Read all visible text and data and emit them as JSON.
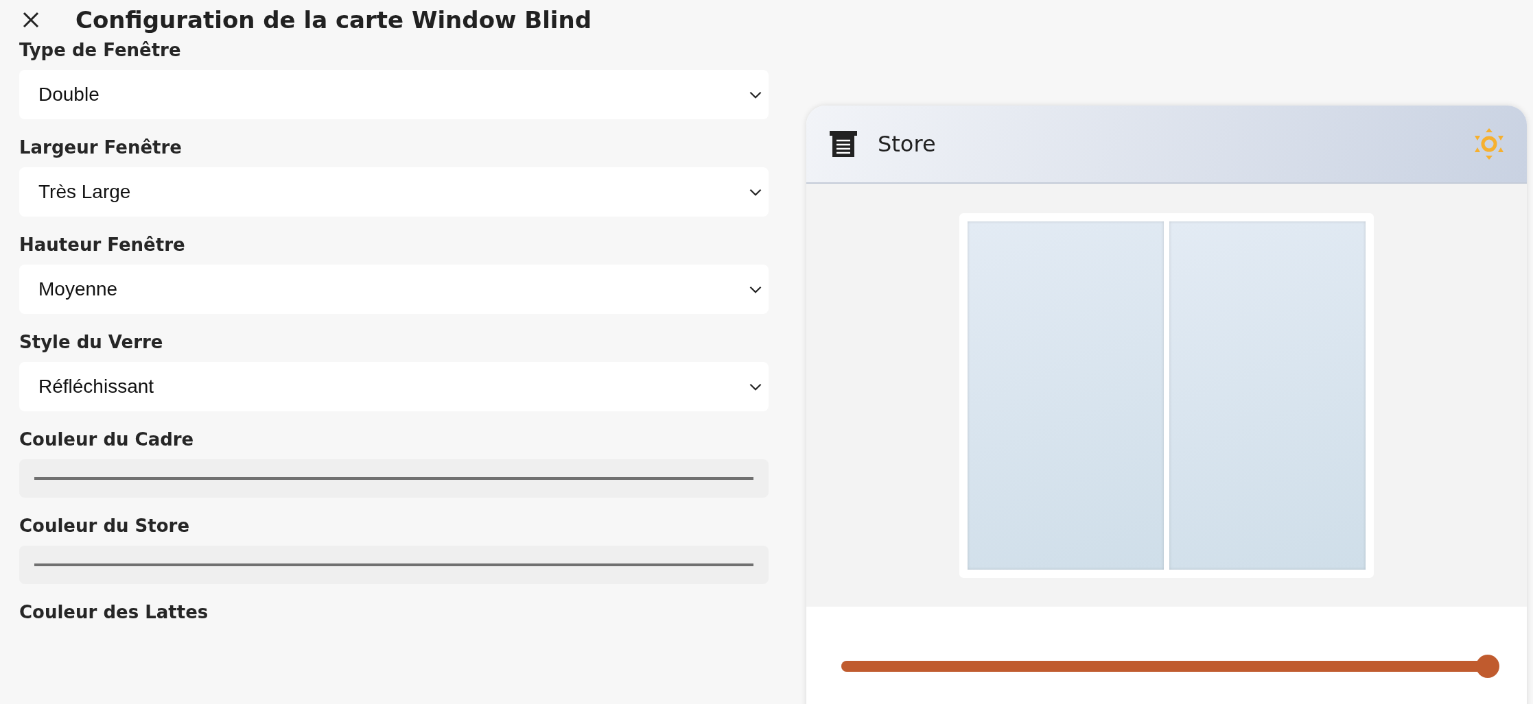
{
  "dialog": {
    "title": "Configuration de la carte Window Blind"
  },
  "fields": [
    {
      "kind": "select",
      "label": "Type de Fenêtre",
      "value": "Double"
    },
    {
      "kind": "select",
      "label": "Largeur Fenêtre",
      "value": "Très Large"
    },
    {
      "kind": "select",
      "label": "Hauteur Fenêtre",
      "value": "Moyenne"
    },
    {
      "kind": "select",
      "label": "Style du Verre",
      "value": "Réfléchissant"
    },
    {
      "kind": "color",
      "label": "Couleur du Cadre"
    },
    {
      "kind": "color",
      "label": "Couleur du Store"
    },
    {
      "kind": "label",
      "label": "Couleur des Lattes"
    }
  ],
  "preview": {
    "title": "Store",
    "position": {
      "level": 1
    }
  }
}
